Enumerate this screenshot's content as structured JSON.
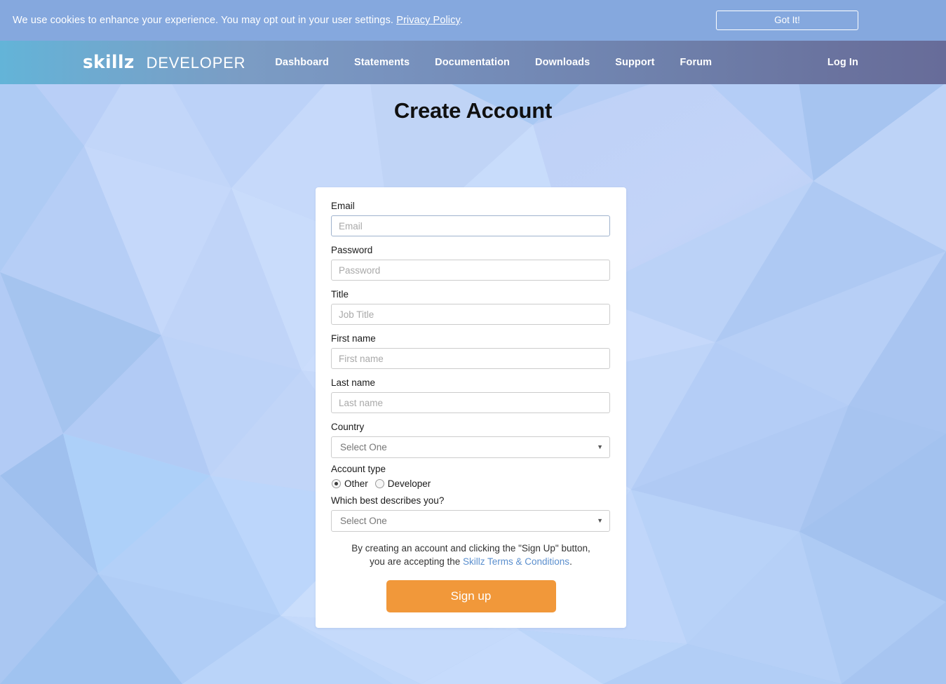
{
  "cookie_bar": {
    "message": "We use cookies to enhance your experience. You may opt out in your user settings.",
    "privacy_link": "Privacy Policy",
    "trailing_period": ".",
    "accept_label": "Got It!",
    "background_color": "#85a8de"
  },
  "navbar": {
    "brand_primary": "skillz",
    "brand_secondary": "DEVELOPER",
    "links": [
      {
        "label": "Dashboard"
      },
      {
        "label": "Statements"
      },
      {
        "label": "Documentation"
      },
      {
        "label": "Downloads"
      },
      {
        "label": "Support"
      },
      {
        "label": "Forum"
      }
    ],
    "login_label": "Log In",
    "gradient_start": "#63b4d8",
    "gradient_end": "#676c99"
  },
  "page": {
    "title": "Create Account",
    "background_base": "#b7cdf5"
  },
  "form": {
    "email": {
      "label": "Email",
      "placeholder": "Email",
      "value": "",
      "focused": true
    },
    "password": {
      "label": "Password",
      "placeholder": "Password",
      "value": ""
    },
    "title": {
      "label": "Title",
      "placeholder": "Job Title",
      "value": ""
    },
    "first_name": {
      "label": "First name",
      "placeholder": "First name",
      "value": ""
    },
    "last_name": {
      "label": "Last name",
      "placeholder": "Last name",
      "value": ""
    },
    "country": {
      "label": "Country",
      "selected": "Select One",
      "caret_icon": "chevron-down-icon"
    },
    "account_type": {
      "label": "Account type",
      "options": [
        {
          "label": "Other",
          "checked": true
        },
        {
          "label": "Developer",
          "checked": false
        }
      ]
    },
    "describes_you": {
      "label": "Which best describes you?",
      "selected": "Select One",
      "caret_icon": "chevron-down-icon"
    },
    "terms": {
      "line1": "By creating an account and clicking the \"Sign Up\" button,",
      "line2_prefix": "you are accepting the ",
      "link": "Skillz Terms & Conditions",
      "line2_suffix": "."
    },
    "submit_label": "Sign up",
    "submit_color": "#f1983a"
  }
}
